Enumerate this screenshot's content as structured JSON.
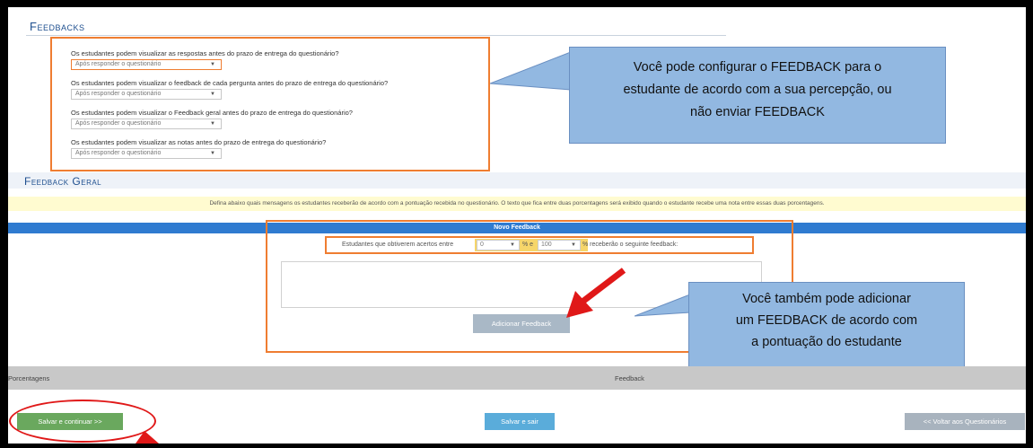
{
  "feedbacks": {
    "title": "Feedbacks",
    "questions": [
      {
        "label": "Os estudantes podem visualizar as respostas antes do prazo de entrega do questionário?",
        "value": "Após responder o questionário"
      },
      {
        "label": "Os estudantes podem visualizar o feedback de cada pergunta antes do prazo de entrega do questionário?",
        "value": "Após responder o questionário"
      },
      {
        "label": "Os estudantes podem visualizar o Feedback geral antes do prazo de entrega do questionário?",
        "value": "Após responder o questionário"
      },
      {
        "label": "Os estudantes podem visualizar as notas antes do prazo de entrega do questionário?",
        "value": "Após responder o questionário"
      }
    ]
  },
  "callout1": {
    "line1": "Você pode configurar o FEEDBACK para o",
    "line2": "estudante de acordo com a sua percepção, ou",
    "line3": "não enviar FEEDBACK"
  },
  "geral": {
    "title": "Feedback Geral",
    "note": "Defina abaixo quais mensagens os estudantes receberão de acordo com a pontuação recebida no questionário. O texto que fica entre duas porcentagens será exibido quando o estudante recebe uma nota entre essas duas porcentagens."
  },
  "novo": {
    "title": "Novo Feedback",
    "prefix": "Estudantes que obtiverem acertos entre",
    "from_value": "0",
    "between": "% e",
    "to_value": "100",
    "suffix": "% receberão o seguinte feedback:",
    "add_button": "Adicionar Feedback"
  },
  "callout2": {
    "line1": "Você também pode adicionar",
    "line2": "um FEEDBACK de acordo com",
    "line3": "a pontuação do estudante"
  },
  "table": {
    "col_percent": "Porcentagens",
    "col_feedback": "Feedback"
  },
  "buttons": {
    "save_continue": "Salvar e continuar >>",
    "save_exit": "Salvar e sair",
    "back": "<< Voltar aos Questionários"
  },
  "colors": {
    "accent_orange": "#ef7d31",
    "callout_blue": "#92b8e1",
    "header_blue": "#2f7bd0",
    "arrow_red": "#e01818"
  }
}
